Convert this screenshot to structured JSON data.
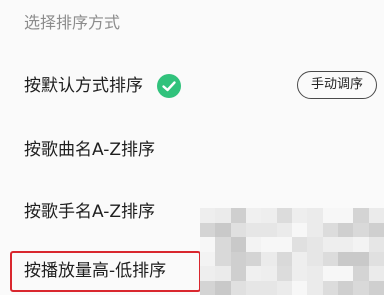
{
  "sheet": {
    "title": "选择排序方式"
  },
  "options": [
    {
      "label": "按默认方式排序",
      "selected": true,
      "selected_icon": "check-circle-icon"
    },
    {
      "label": "按歌曲名A-Z排序",
      "selected": false
    },
    {
      "label": "按歌手名A-Z排序",
      "selected": false
    },
    {
      "label": "按播放量高-低排序",
      "selected": false,
      "highlighted": true
    }
  ],
  "manual_sort_button": {
    "label": "手动调序"
  },
  "colors": {
    "accent": "#31c27c",
    "highlight": "#d9272e",
    "title_text": "#8c8c8c",
    "body_text": "#1f1f1f"
  }
}
